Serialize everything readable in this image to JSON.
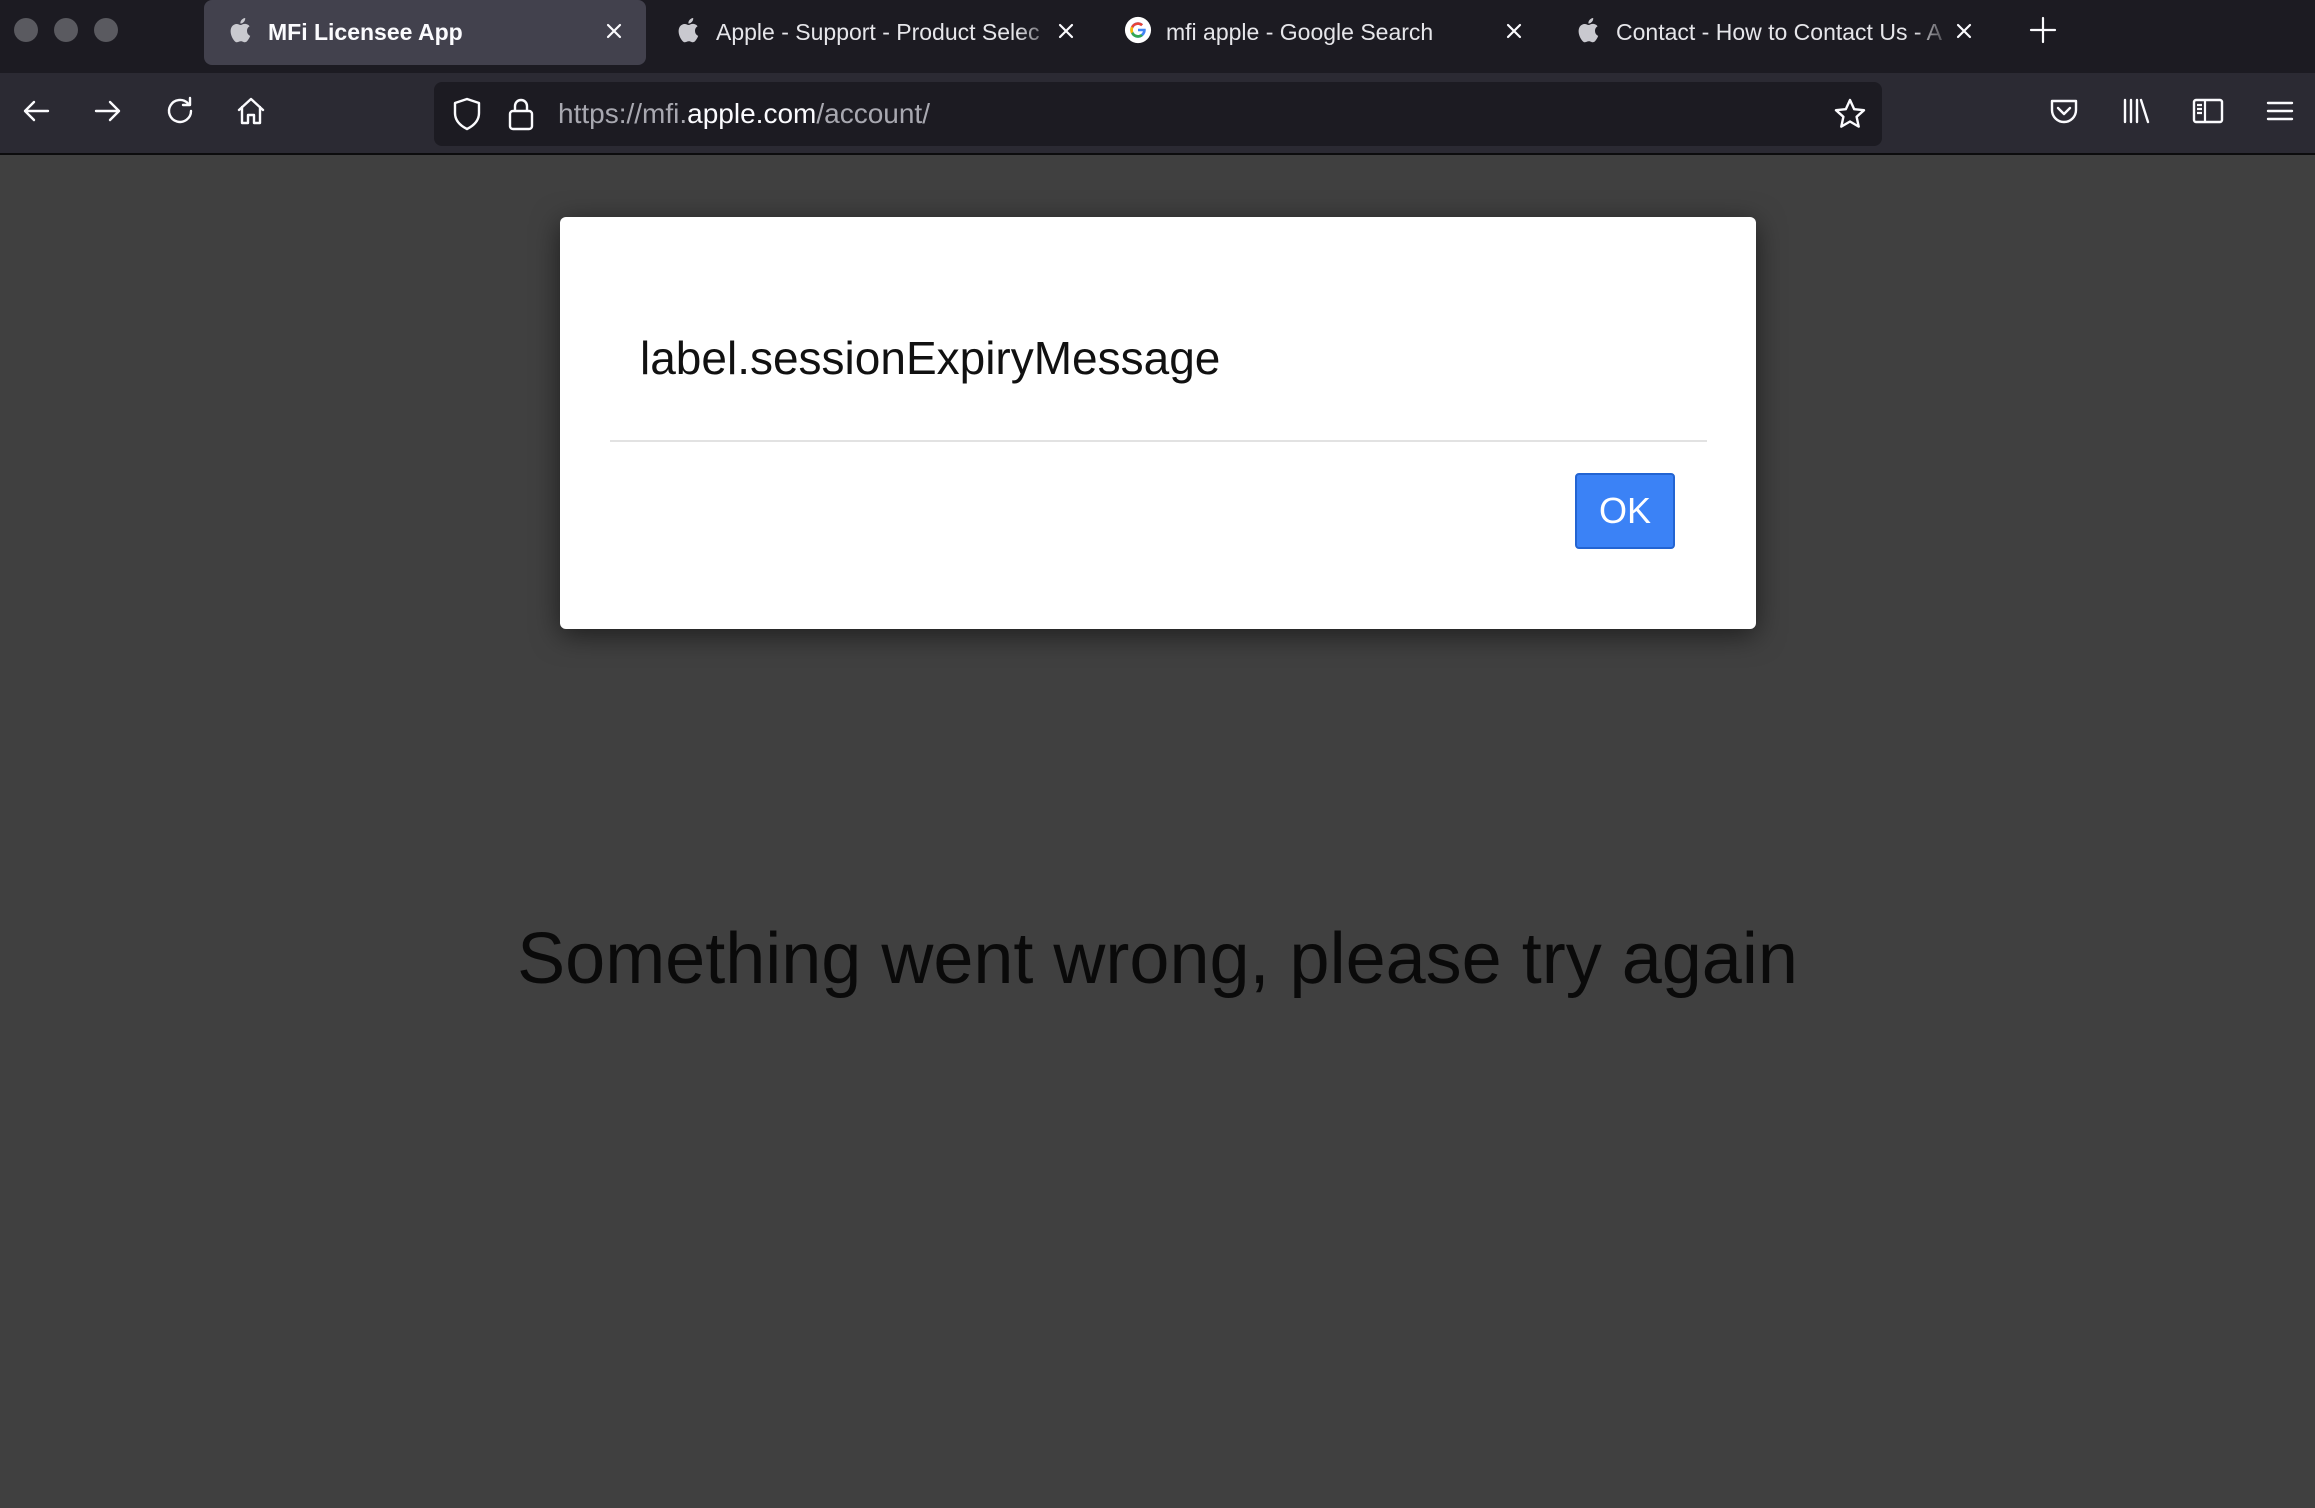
{
  "browser": {
    "tabs": [
      {
        "title": "MFi Licensee App",
        "favicon": "apple-logo-icon",
        "active": true
      },
      {
        "title": "Apple - Support - Product Selec",
        "favicon": "apple-logo-icon",
        "active": false
      },
      {
        "title": "mfi apple - Google Search",
        "favicon": "google-logo-icon",
        "active": false
      },
      {
        "title": "Contact - How to Contact Us - A",
        "favicon": "apple-logo-icon",
        "active": false
      }
    ],
    "url": {
      "prefix": "https://mfi.",
      "host": "apple.com",
      "path": "/account/"
    },
    "colors": {
      "tabstrip": "#1c1b22",
      "toolbar": "#2b2a33",
      "active_tab": "#42414d",
      "page_background": "#404040",
      "primary_button": "#3b82f6"
    }
  },
  "dialog": {
    "message": "label.sessionExpiryMessage",
    "ok_label": "OK"
  },
  "page": {
    "error_text": "Something went wrong, please try again"
  }
}
